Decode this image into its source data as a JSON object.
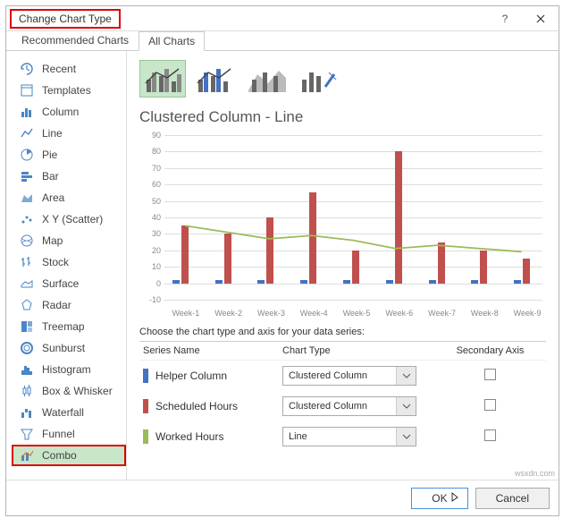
{
  "window": {
    "title": "Change Chart Type",
    "help_tooltip": "Help",
    "close_tooltip": "Close"
  },
  "tabs": {
    "recommended": "Recommended Charts",
    "all": "All Charts"
  },
  "sidebar": {
    "recent": "Recent",
    "templates": "Templates",
    "column": "Column",
    "line": "Line",
    "pie": "Pie",
    "bar": "Bar",
    "area": "Area",
    "xy": "X Y (Scatter)",
    "map": "Map",
    "stock": "Stock",
    "surface": "Surface",
    "radar": "Radar",
    "treemap": "Treemap",
    "sunburst": "Sunburst",
    "histogram": "Histogram",
    "boxwhisker": "Box & Whisker",
    "waterfall": "Waterfall",
    "funnel": "Funnel",
    "combo": "Combo"
  },
  "main": {
    "subtype_title": "Clustered Column - Line",
    "legend_note": "Choose the chart type and axis for your data series:",
    "headers": {
      "series_name": "Series Name",
      "chart_type": "Chart Type",
      "secondary_axis": "Secondary Axis"
    }
  },
  "series": {
    "helper": {
      "name": "Helper Column",
      "type": "Clustered Column",
      "color": "#4472c4"
    },
    "scheduled": {
      "name": "Scheduled Hours",
      "type": "Clustered Column",
      "color": "#c0504d"
    },
    "worked": {
      "name": "Worked Hours",
      "type": "Line",
      "color": "#9bbb59"
    }
  },
  "footer": {
    "ok": "OK",
    "cancel": "Cancel"
  },
  "watermark": "wsxdn.com",
  "chart_data": {
    "type": "combo",
    "title": "Clustered Column - Line",
    "xlabel": "",
    "ylabel": "",
    "ylim": [
      -10,
      90
    ],
    "y_ticks": [
      -10,
      0,
      10,
      20,
      30,
      40,
      50,
      60,
      70,
      80,
      90
    ],
    "categories": [
      "Week-1",
      "Week-2",
      "Week-3",
      "Week-4",
      "Week-5",
      "Week-6",
      "Week-7",
      "Week-8",
      "Week-9"
    ],
    "series": [
      {
        "name": "Helper Column",
        "type": "bar",
        "color": "#4472c4",
        "values": [
          2,
          2,
          2,
          2,
          2,
          2,
          2,
          2,
          2
        ]
      },
      {
        "name": "Scheduled Hours",
        "type": "bar",
        "color": "#c0504d",
        "values": [
          35,
          30,
          40,
          55,
          20,
          80,
          25,
          20,
          15
        ]
      },
      {
        "name": "Worked Hours",
        "type": "line",
        "color": "#9bbb59",
        "values": [
          34,
          30,
          26,
          28,
          25,
          20,
          22,
          20,
          18
        ]
      }
    ]
  }
}
